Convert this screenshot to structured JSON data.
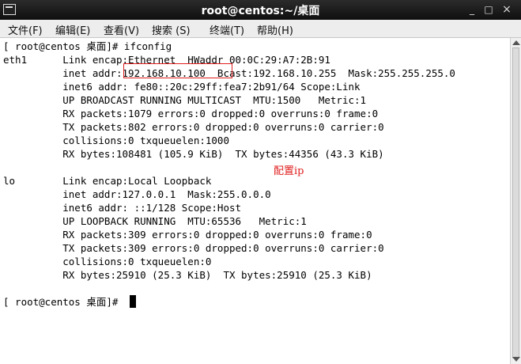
{
  "window": {
    "title": "root@centos:~/桌面",
    "minimize": "_",
    "maximize": "□",
    "close": "×"
  },
  "menu": [
    "文件(F)",
    "编辑(E)",
    "查看(V)",
    "搜索 (S)",
    "终端(T)",
    "帮助(H)"
  ],
  "terminal": {
    "lines": [
      "[ root@centos 桌面]# ifconfig",
      "eth1      Link encap:Ethernet  HWaddr 00:0C:29:A7:2B:91",
      "          inet addr:192.168.10.100  Bcast:192.168.10.255  Mask:255.255.255.0",
      "          inet6 addr: fe80::20c:29ff:fea7:2b91/64 Scope:Link",
      "          UP BROADCAST RUNNING MULTICAST  MTU:1500   Metric:1",
      "          RX packets:1079 errors:0 dropped:0 overruns:0 frame:0",
      "          TX packets:802 errors:0 dropped:0 overruns:0 carrier:0",
      "          collisions:0 txqueuelen:1000",
      "          RX bytes:108481 (105.9 KiB)  TX bytes:44356 (43.3 KiB)",
      "",
      "lo        Link encap:Local Loopback",
      "          inet addr:127.0.0.1  Mask:255.0.0.0",
      "          inet6 addr: ::1/128 Scope:Host",
      "          UP LOOPBACK RUNNING  MTU:65536   Metric:1",
      "          RX packets:309 errors:0 dropped:0 overruns:0 frame:0",
      "          TX packets:309 errors:0 dropped:0 overruns:0 carrier:0",
      "          collisions:0 txqueuelen:0",
      "          RX bytes:25910 (25.3 KiB)  TX bytes:25910 (25.3 KiB)",
      "",
      "[ root@centos 桌面]# "
    ],
    "annotation": "配置ip",
    "highlight_color": "#e02020"
  }
}
